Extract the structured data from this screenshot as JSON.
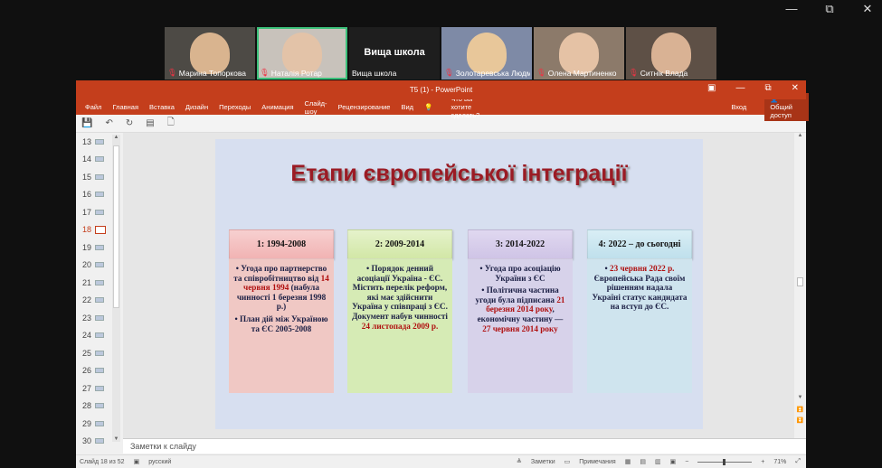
{
  "window_controls": {
    "minimize": "—",
    "restore": "⧉",
    "close": "✕"
  },
  "participants": [
    {
      "name": "Марина Топоркова",
      "bg": "#4d4a45",
      "face": "#d9b48f",
      "muted": true
    },
    {
      "name": "Наталія Ротар",
      "bg": "#c8c2bb",
      "face": "#e3c3a8",
      "muted": true,
      "active": true
    },
    {
      "name": "Вища школа",
      "label": "Вища школа",
      "bg": "#1e1e1e",
      "face": ""
    },
    {
      "name": "Золотаревська Людм...",
      "bg": "#7e8aa6",
      "face": "#e8c79a",
      "muted": true
    },
    {
      "name": "Олена Мартиненко",
      "bg": "#8c7a6a",
      "face": "#e5c2a5",
      "muted": true
    },
    {
      "name": "Ситнік Влада",
      "bg": "#5e5046",
      "face": "#d9b294",
      "muted": true
    }
  ],
  "powerpoint": {
    "title": "T5 (1) - PowerPoint",
    "ribbon_tabs": [
      "Файл",
      "Главная",
      "Вставка",
      "Дизайн",
      "Переходы",
      "Анимация",
      "Слайд-шоу",
      "Рецензирование",
      "Вид"
    ],
    "tell_me": "Что вы хотите сделать?",
    "sign_in": "Вход",
    "share": "Общий доступ",
    "thumbnails": [
      "13",
      "14",
      "15",
      "16",
      "17",
      "18",
      "19",
      "20",
      "21",
      "22",
      "23",
      "24",
      "25",
      "26",
      "27",
      "28",
      "29",
      "30"
    ],
    "selected_thumbnail": "18",
    "notes_placeholder": "Заметки к слайду",
    "status": {
      "slide": "Слайд 18 из 52",
      "language": "русский",
      "notes": "Заметки",
      "comments": "Примечания",
      "zoom": "71%"
    }
  },
  "slide": {
    "title": "Етапи європейської інтеграції",
    "cards": [
      {
        "header": "1: 1994-2008",
        "b1a": "• Угода про партнерство та співробітництво від ",
        "b1r": "14 червня 1994",
        "b1b": " (набула чинності 1 березня 1998 р.)",
        "b2a": "• План дій між Україною та ЄС 2005-2008",
        "b2r": "",
        "b2b": ""
      },
      {
        "header": "2: 2009-2014",
        "b1a": "• Порядок денний асоціації Україна - ЄС. Містить перелік реформ, які має здійснити Україна у співпраці з ЄС. Документ набув чинності ",
        "b1r": "24 листопада 2009 р.",
        "b1b": "",
        "b2a": "",
        "b2r": "",
        "b2b": ""
      },
      {
        "header": "3: 2014-2022",
        "b1a": "• Угода про асоціацію України з ЄС",
        "b1r": "",
        "b1b": "",
        "b2a": "• Політична частина угоди була підписана ",
        "b2r": "21 березня 2014 року",
        "b2b": ", економічну частину — ",
        "b3r": "27 червня 2014 року"
      },
      {
        "header": "4: 2022 – до сьогодні",
        "b1a": "• ",
        "b1r": "23 червня 2022 р.",
        "b1b": " Європейська Рада своїм рішенням надала Україні статус кандидата на вступ до ЄС.",
        "b2a": "",
        "b2r": "",
        "b2b": ""
      }
    ]
  }
}
